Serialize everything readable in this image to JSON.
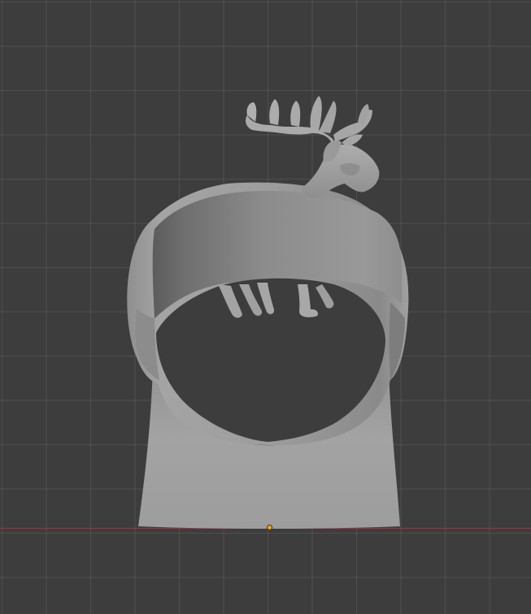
{
  "viewport": {
    "background_color": "#3d3d3d",
    "grid_color": "#4a4a4a",
    "x_axis_color": "#8a3b47",
    "model_color": "#9a9a9a",
    "origin_color": "#f0a030"
  },
  "scene": {
    "object": "reindeer-napkin-ring-icon",
    "origin": "object-origin-icon"
  }
}
